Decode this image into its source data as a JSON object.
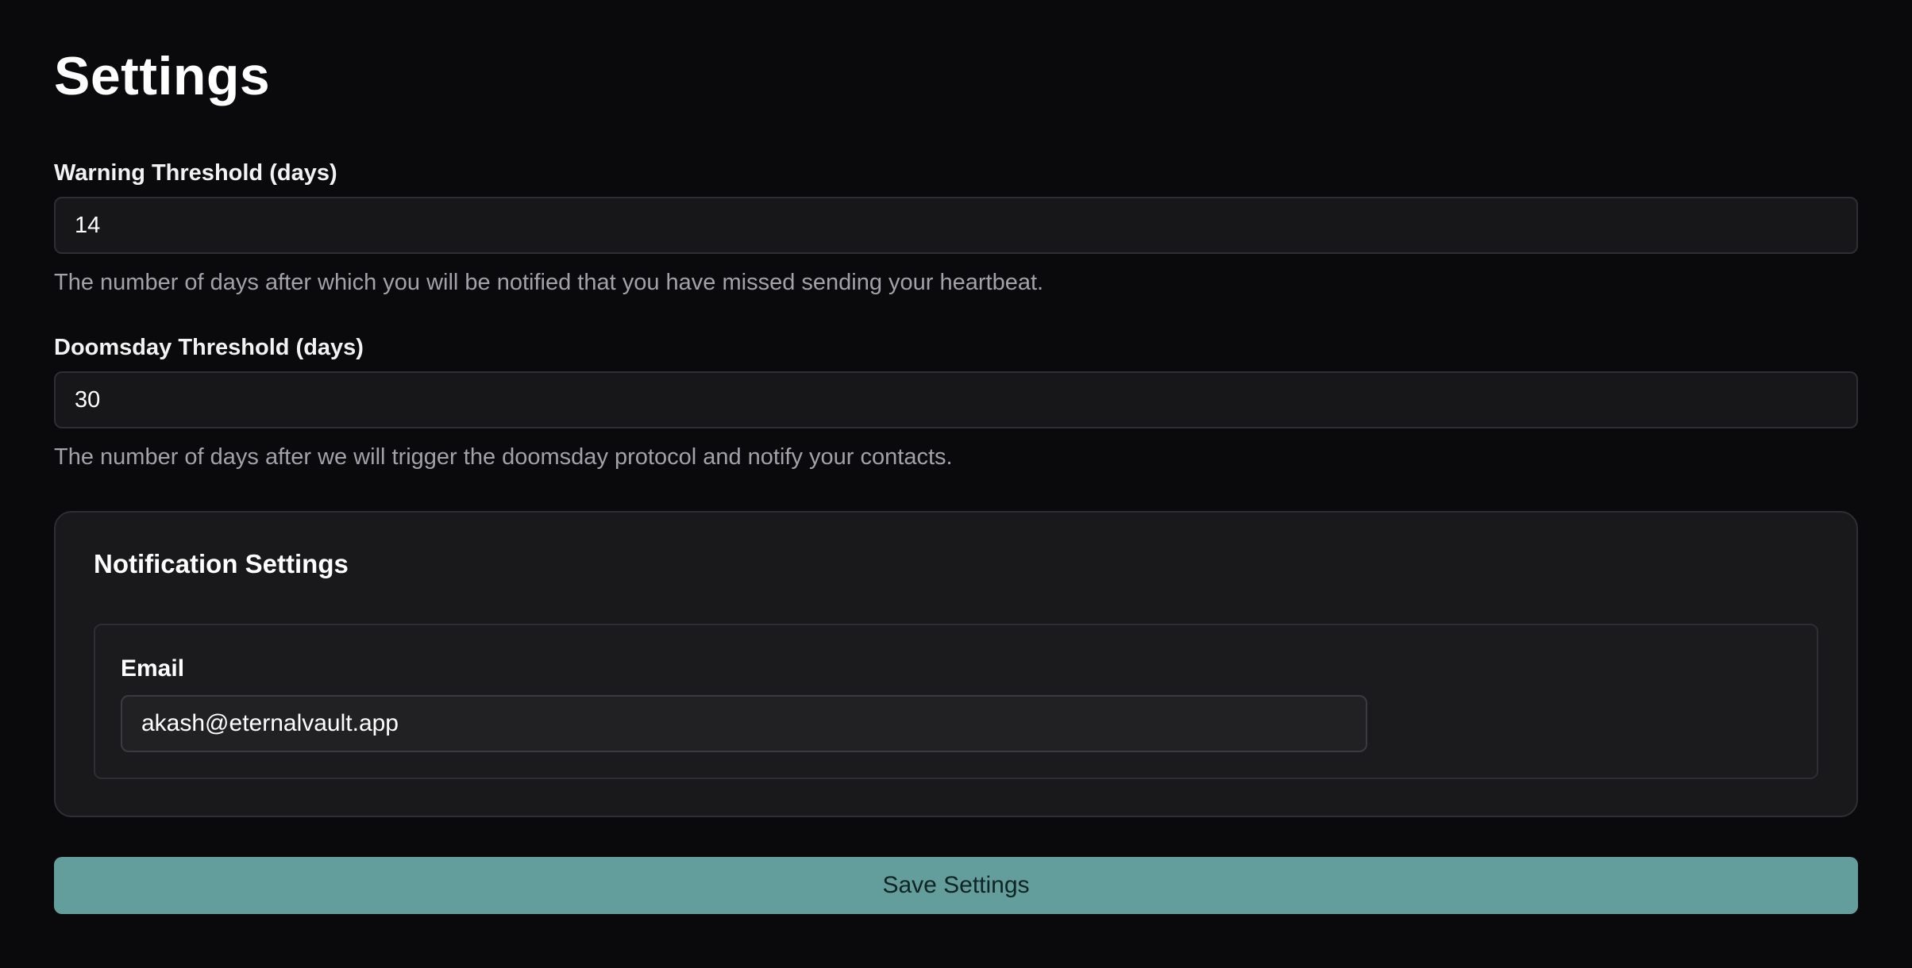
{
  "page": {
    "title": "Settings"
  },
  "warning": {
    "label": "Warning Threshold (days)",
    "value": "14",
    "help": "The number of days after which you will be notified that you have missed sending your heartbeat."
  },
  "doomsday": {
    "label": "Doomsday Threshold (days)",
    "value": "30",
    "help": "The number of days after we will trigger the doomsday protocol and notify your contacts."
  },
  "notifications": {
    "title": "Notification Settings",
    "email": {
      "label": "Email",
      "value": "akash@eternalvault.app"
    }
  },
  "actions": {
    "save_label": "Save Settings"
  },
  "colors": {
    "background": "#0a0a0c",
    "accent": "#639d9c",
    "muted_text": "#a2a2a8"
  }
}
